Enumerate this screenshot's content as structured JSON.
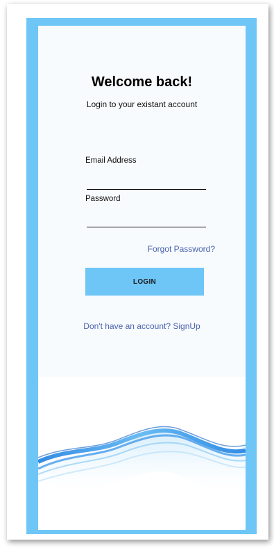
{
  "login": {
    "title": "Welcome back!",
    "subtitle": "Login to your existant account",
    "email_label": "Email Address",
    "email_value": "",
    "password_label": "Password",
    "password_value": "",
    "forgot_link": "Forgot Password?",
    "login_button": "LOGIN",
    "signup_link": "Don't have an account? SignUp"
  },
  "colors": {
    "accent": "#6ec6f7",
    "link": "#4a63b0",
    "wave": "#1e7fe0"
  }
}
